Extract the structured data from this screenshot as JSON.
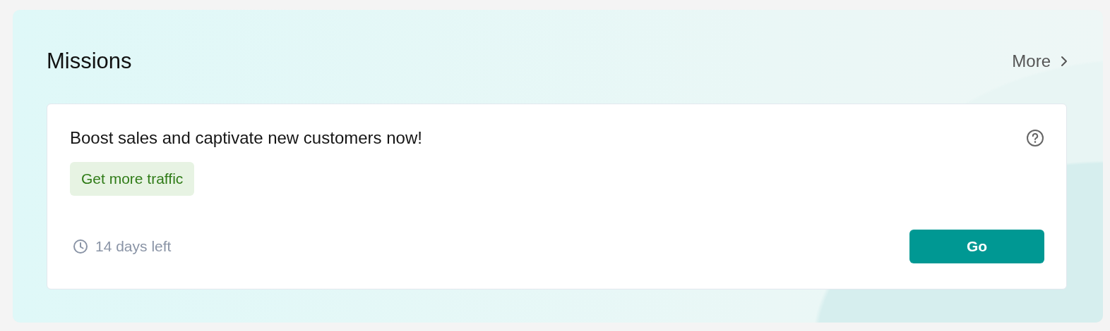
{
  "section": {
    "title": "Missions",
    "more_link": "More"
  },
  "mission_card": {
    "heading": "Boost sales and captivate new customers now!",
    "tag": "Get more traffic",
    "time_left": "14 days left",
    "button": "Go"
  }
}
